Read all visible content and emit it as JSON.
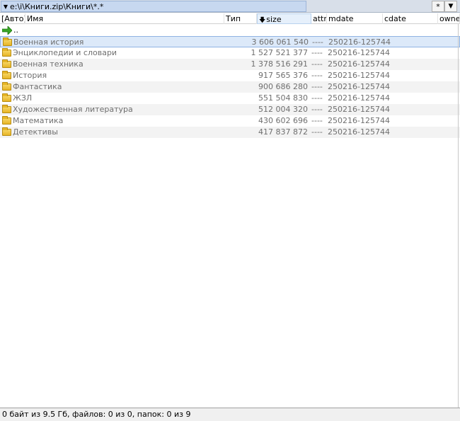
{
  "path_bar": {
    "path": "e:\\i\\Книги.zip\\Книги\\*.*",
    "star_label": "*",
    "dropdown_label": "▼"
  },
  "header": {
    "auto": "[Авто]",
    "name": "Имя",
    "type": "Тип",
    "size": "size",
    "attr": "attr",
    "mdate": "mdate",
    "cdate": "cdate",
    "owner": "owne"
  },
  "parent_dir": "..",
  "files": [
    {
      "name": "Военная история",
      "size": "3 606 061 540",
      "attr": "----",
      "mdate": "250216-125744"
    },
    {
      "name": "Энциклопедии и словари",
      "size": "1 527 521 377",
      "attr": "----",
      "mdate": "250216-125744"
    },
    {
      "name": "Военная техника",
      "size": "1 378 516 291",
      "attr": "----",
      "mdate": "250216-125744"
    },
    {
      "name": "История",
      "size": "917 565 376",
      "attr": "----",
      "mdate": "250216-125744"
    },
    {
      "name": "Фантастика",
      "size": "900 686 280",
      "attr": "----",
      "mdate": "250216-125744"
    },
    {
      "name": "ЖЗЛ",
      "size": "551 504 830",
      "attr": "----",
      "mdate": "250216-125744"
    },
    {
      "name": "Художественная литература",
      "size": "512 004 320",
      "attr": "----",
      "mdate": "250216-125744"
    },
    {
      "name": "Математика",
      "size": "430 602 696",
      "attr": "----",
      "mdate": "250216-125744"
    },
    {
      "name": "Детективы",
      "size": "417 837 872",
      "attr": "----",
      "mdate": "250216-125744"
    }
  ],
  "status": "0 байт из 9.5 Гб, файлов: 0 из 0, папок: 0 из 9",
  "colors": {
    "selected_row": "#dce9f9",
    "alt_row": "#f3f3f3",
    "folder": "#e7b526",
    "up_arrow": "#3aa626"
  }
}
